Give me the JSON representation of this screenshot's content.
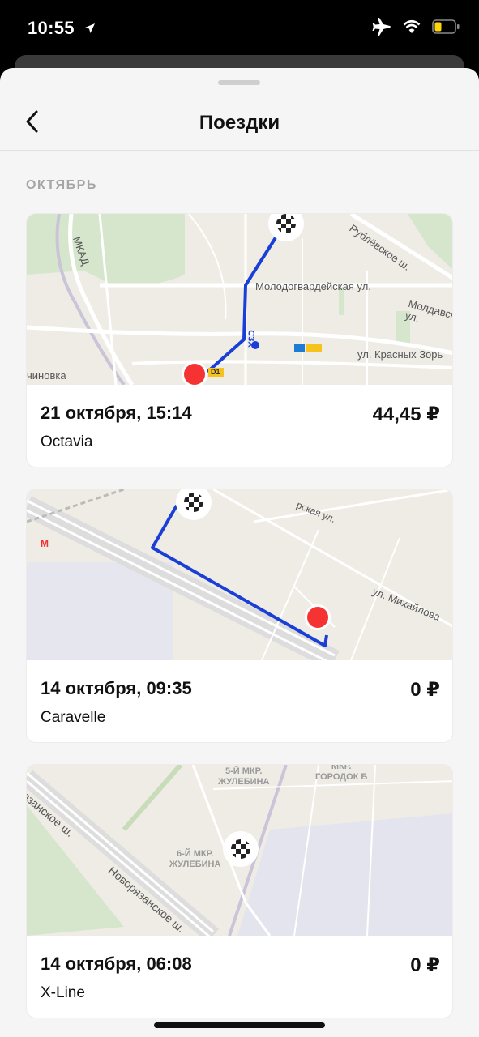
{
  "status_bar": {
    "time": "10:55"
  },
  "nav": {
    "title": "Поездки"
  },
  "section": {
    "label": "ОКТЯБРЬ"
  },
  "trips": [
    {
      "date": "21 октября, 15:14",
      "price": "44,45 ₽",
      "car": "Octavia",
      "map_labels": {
        "mkad": "МКАД",
        "road1": "Молодогвардейская ул.",
        "road2": "ул. Красных Зорь",
        "road3": "Молдавская ул.",
        "road4": "Рублёвское ш.",
        "district": "чиновка",
        "route": "С3Х",
        "badge": "D1"
      }
    },
    {
      "date": "14 октября, 09:35",
      "price": "0 ₽",
      "car": "Caravelle",
      "map_labels": {
        "road1": "ул. Михайлова",
        "road2": "рская ул.",
        "metro": "M"
      }
    },
    {
      "date": "14 октября, 06:08",
      "price": "0 ₽",
      "car": "X-Line",
      "map_labels": {
        "d1a": "5-Й МКР.",
        "d1b": "ЖУЛЕБИНА",
        "d2a": "6-Й МКР.",
        "d2b": "ЖУЛЕБИНА",
        "d3a": "МКР.",
        "d3b": "ГОРОДОК Б",
        "road1": "Новорязанское ш.",
        "road2": "язанское ш."
      }
    }
  ],
  "colors": {
    "route": "#1a3fd6",
    "start_pin": "#f53333",
    "background": "#f5f5f5"
  }
}
